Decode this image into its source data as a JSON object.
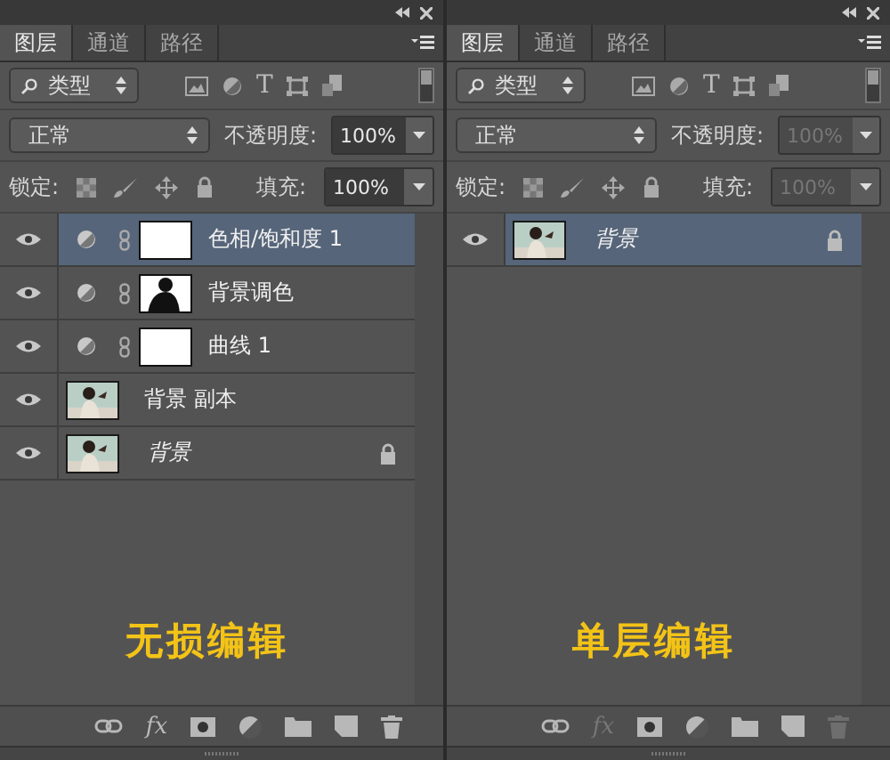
{
  "panels": [
    {
      "tabs": [
        {
          "label": "图层",
          "selected": true
        },
        {
          "label": "通道",
          "selected": false
        },
        {
          "label": "路径",
          "selected": false
        }
      ],
      "filter": {
        "value": "类型",
        "type_glyph": "T"
      },
      "blend": {
        "value": "正常",
        "opacity_label": "不透明度:",
        "opacity": "100%",
        "fill_label": "填充:",
        "fill": "100%",
        "disabled": false
      },
      "lock_label": "锁定:",
      "layers": [
        {
          "kind": "adjustment",
          "name": "色相/饱和度 1",
          "mask": {
            "kind": "white"
          },
          "selected": true,
          "locked": false,
          "italic": false
        },
        {
          "kind": "adjustment",
          "name": "背景调色",
          "mask": {
            "kind": "figure"
          },
          "selected": false,
          "locked": false,
          "italic": false
        },
        {
          "kind": "adjustment",
          "name": "曲线 1",
          "mask": {
            "kind": "white"
          },
          "selected": false,
          "locked": false,
          "italic": false
        },
        {
          "kind": "pixel",
          "name": "背景 副本",
          "selected": false,
          "locked": false,
          "italic": false
        },
        {
          "kind": "pixel",
          "name": "背景",
          "selected": false,
          "locked": true,
          "italic": true
        }
      ],
      "caption": "无损编辑",
      "footer": [
        {
          "kind": "link",
          "disabled": false
        },
        {
          "kind": "fx",
          "label": "fx",
          "disabled": false
        },
        {
          "kind": "mask",
          "disabled": false
        },
        {
          "kind": "adjust",
          "disabled": false
        },
        {
          "kind": "folder",
          "disabled": false
        },
        {
          "kind": "new",
          "disabled": false
        },
        {
          "kind": "trash",
          "disabled": false
        }
      ]
    },
    {
      "tabs": [
        {
          "label": "图层",
          "selected": true
        },
        {
          "label": "通道",
          "selected": false
        },
        {
          "label": "路径",
          "selected": false
        }
      ],
      "filter": {
        "value": "类型",
        "type_glyph": "T"
      },
      "blend": {
        "value": "正常",
        "opacity_label": "不透明度:",
        "opacity": "100%",
        "fill_label": "填充:",
        "fill": "100%",
        "disabled": true
      },
      "lock_label": "锁定:",
      "layers": [
        {
          "kind": "pixel",
          "name": "背景",
          "selected": true,
          "locked": true,
          "italic": true
        }
      ],
      "caption": "单层编辑",
      "footer": [
        {
          "kind": "link",
          "disabled": false
        },
        {
          "kind": "fx",
          "label": "fx",
          "disabled": true
        },
        {
          "kind": "mask",
          "disabled": false
        },
        {
          "kind": "adjust",
          "disabled": false
        },
        {
          "kind": "folder",
          "disabled": false
        },
        {
          "kind": "new",
          "disabled": false
        },
        {
          "kind": "trash",
          "disabled": true
        }
      ]
    }
  ]
}
